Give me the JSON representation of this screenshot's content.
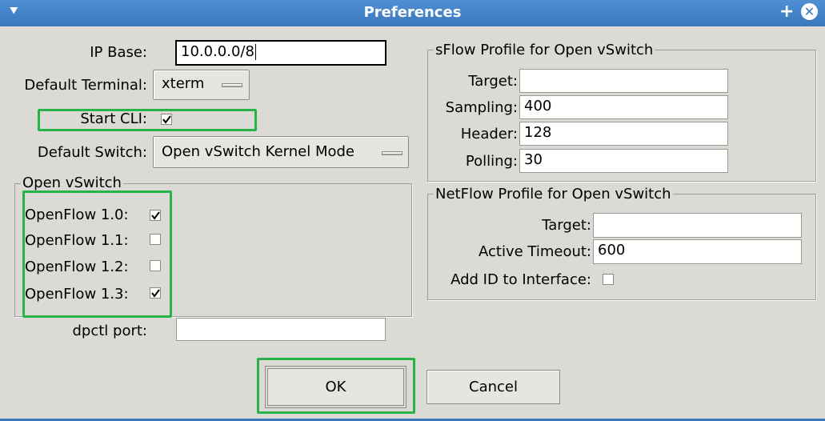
{
  "window": {
    "title": "Preferences",
    "menu_glyph": "⯆",
    "plus_glyph": "+",
    "close_glyph": "✕"
  },
  "left": {
    "ip_base_label": "IP Base:",
    "ip_base_value": "10.0.0.0/8",
    "default_terminal_label": "Default Terminal:",
    "default_terminal_value": "xterm",
    "start_cli_label": "Start CLI:",
    "start_cli_checked": true,
    "default_switch_label": "Default Switch:",
    "default_switch_value": "Open vSwitch Kernel Mode",
    "dpctl_port_label": "dpctl port:",
    "dpctl_port_value": ""
  },
  "open_vswitch": {
    "title": "Open vSwitch",
    "items": [
      {
        "label": "OpenFlow 1.0:",
        "checked": true
      },
      {
        "label": "OpenFlow 1.1:",
        "checked": false
      },
      {
        "label": "OpenFlow 1.2:",
        "checked": false
      },
      {
        "label": "OpenFlow 1.3:",
        "checked": true
      }
    ]
  },
  "sflow": {
    "title": "sFlow Profile for Open vSwitch",
    "target_label": "Target:",
    "target_value": "",
    "sampling_label": "Sampling:",
    "sampling_value": "400",
    "header_label": "Header:",
    "header_value": "128",
    "polling_label": "Polling:",
    "polling_value": "30"
  },
  "netflow": {
    "title": "NetFlow Profile for Open vSwitch",
    "target_label": "Target:",
    "target_value": "",
    "active_timeout_label": "Active Timeout:",
    "active_timeout_value": "600",
    "add_id_label": "Add ID to Interface:",
    "add_id_checked": false
  },
  "buttons": {
    "ok_label": "OK",
    "cancel_label": "Cancel"
  },
  "colors": {
    "titlebar": "#3b78be",
    "background": "#dcdad5",
    "highlight": "#27b34a"
  }
}
